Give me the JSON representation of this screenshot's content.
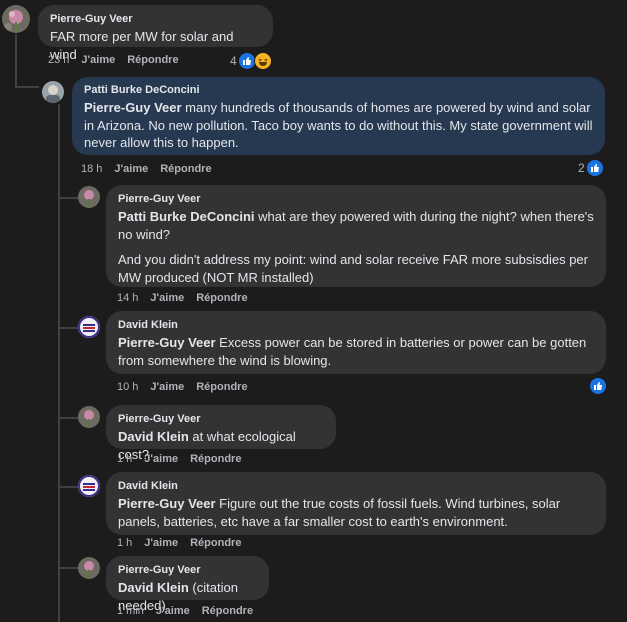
{
  "comments": [
    {
      "author": "Pierre-Guy Veer",
      "mention": "",
      "paragraphs": [
        "FAR more per MW for solar and wind"
      ],
      "time": "23 h",
      "like_label": "J'aime",
      "reply_label": "Répondre",
      "reaction_count": "4",
      "reactions": [
        "like-icon",
        "haha-icon"
      ]
    },
    {
      "author": "Patti Burke DeConcini",
      "mention": "Pierre-Guy Veer",
      "paragraphs": [
        " many hundreds of thousands of homes are powered by wind and solar in Arizona. No new pollution. Taco boy wants to do without this. My state government will never allow this to happen."
      ],
      "time": "18 h",
      "like_label": "J'aime",
      "reply_label": "Répondre",
      "reaction_count": "2",
      "reactions": [
        "like-icon"
      ]
    },
    {
      "author": "Pierre-Guy Veer",
      "mention": "Patti Burke DeConcini",
      "paragraphs": [
        " what are they powered with during the night? when there's no wind?",
        "And you didn't address my point: wind and solar receive FAR more subsisdies per MW produced (NOT MR installed)"
      ],
      "time": "14 h",
      "like_label": "J'aime",
      "reply_label": "Répondre"
    },
    {
      "author": "David Klein",
      "mention": "Pierre-Guy Veer",
      "paragraphs": [
        " Excess power can be stored in batteries or power can be gotten from somewhere the wind is blowing."
      ],
      "time": "10 h",
      "like_label": "J'aime",
      "reply_label": "Répondre",
      "reaction_count": "",
      "reactions": [
        "like-icon"
      ]
    },
    {
      "author": "Pierre-Guy Veer",
      "mention": "David Klein",
      "paragraphs": [
        " at what ecological cost?"
      ],
      "time": "1 h",
      "like_label": "J'aime",
      "reply_label": "Répondre"
    },
    {
      "author": "David Klein",
      "mention": "Pierre-Guy Veer",
      "paragraphs": [
        " Figure out the true costs of fossil fuels. Wind turbines, solar panels, batteries, etc have a far smaller cost to earth's environment."
      ],
      "time": "1 h",
      "like_label": "J'aime",
      "reply_label": "Répondre"
    },
    {
      "author": "Pierre-Guy Veer",
      "mention": "David Klein",
      "paragraphs": [
        " (citation needed)"
      ],
      "time": "1 min",
      "like_label": "J'aime",
      "reply_label": "Répondre"
    }
  ],
  "colors": {
    "background": "#1c1c1d",
    "bubble": "#333334",
    "highlight_bubble": "#263951",
    "like_blue": "#1b74e4",
    "haha_yellow": "#f7b125"
  }
}
